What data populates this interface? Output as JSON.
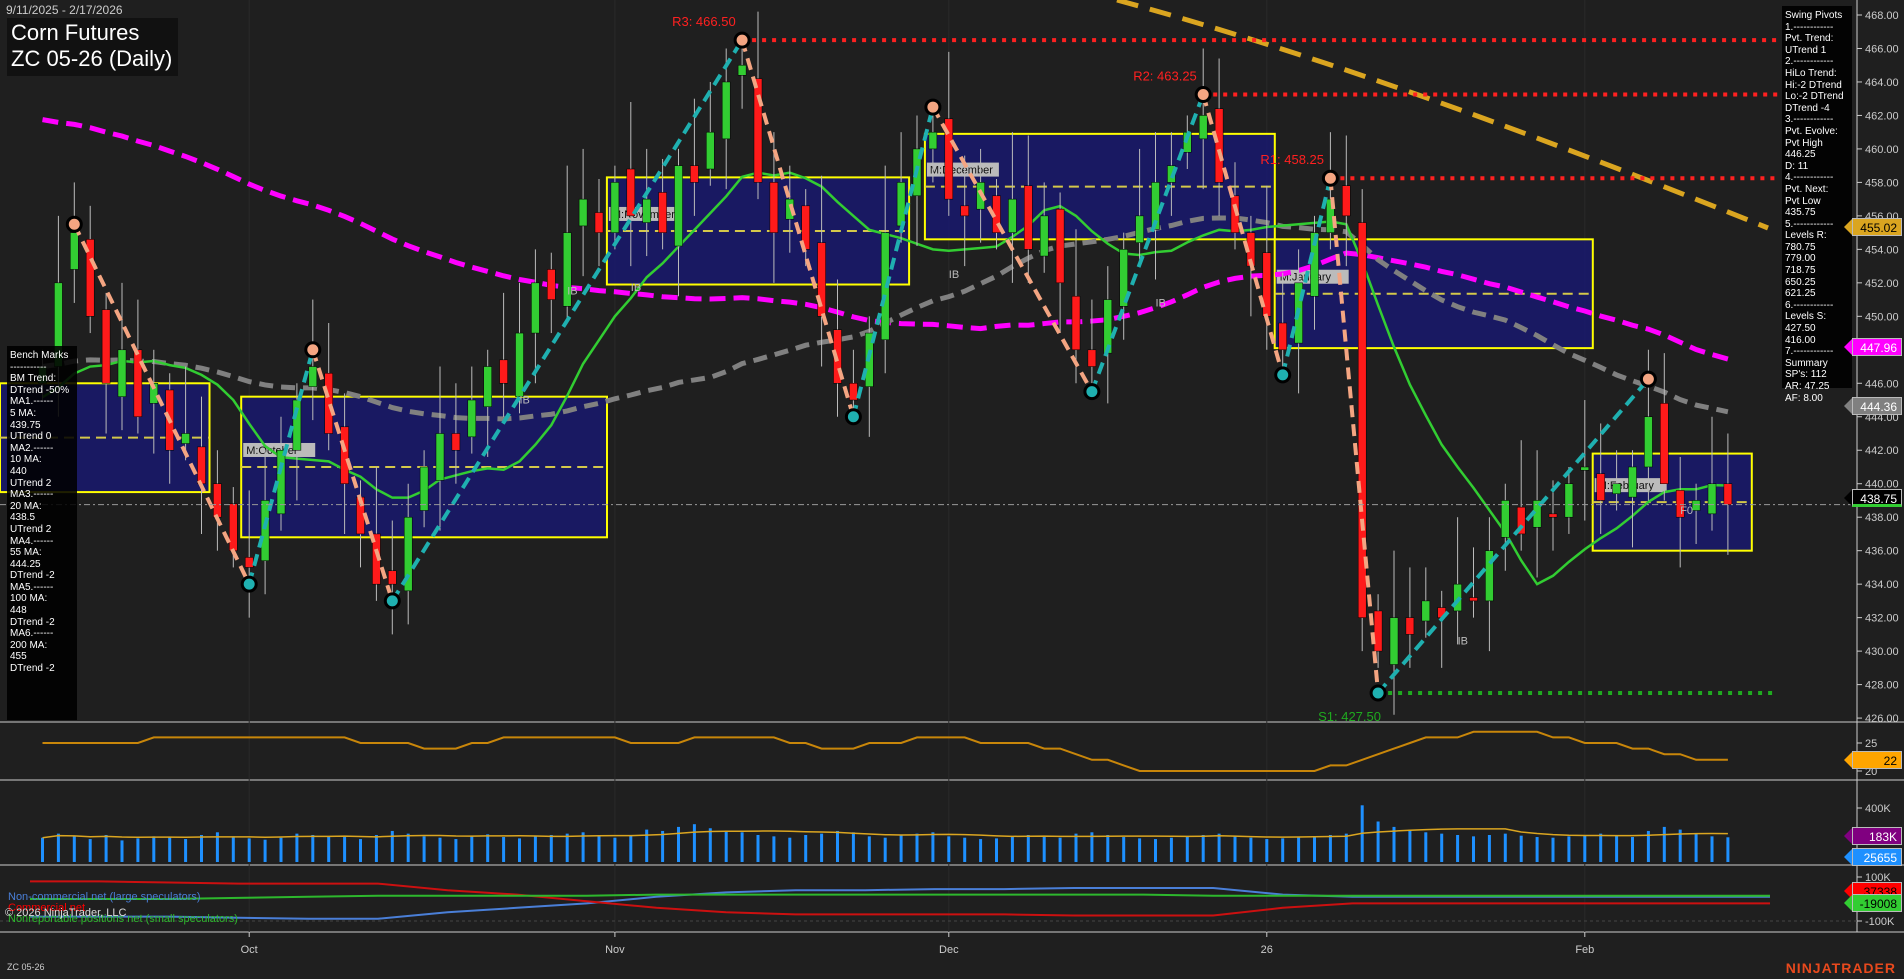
{
  "header": {
    "date_range": "9/11/2025 - 2/17/2026",
    "title_line1": "Corn Futures",
    "title_line2": "ZC 05-26 (Daily)"
  },
  "footer": {
    "symbol": "ZC 05-26",
    "brand": "NINJATRADER",
    "copyright": "© 2026 NinjaTrader, LLC"
  },
  "bench_marks": [
    "Bench Marks",
    "-----------",
    "BM Trend:",
    "DTrend -50%",
    "MA1.------",
    "5 MA:",
    "439.75",
    "UTrend 0",
    "MA2.------",
    "10 MA:",
    "440",
    "UTrend 2",
    "MA3.------",
    "20 MA:",
    "438.5",
    "UTrend 2",
    "MA4.------",
    "55 MA:",
    "444.25",
    "DTrend -2",
    "MA5.------",
    "100 MA:",
    "448",
    "DTrend -2",
    "MA6.------",
    "200 MA:",
    "455",
    "DTrend -2"
  ],
  "swing_pivots": [
    "Swing Pivots",
    "1.------------",
    "Pvt. Trend:",
    "UTrend 1",
    "2.------------",
    "HiLo Trend:",
    "Hi:-2 DTrend",
    "Lo:-2 DTrend",
    "DTrend -4",
    "3.------------",
    "Pvt. Evolve:",
    "Pvt High",
    "446.25",
    "D: 11",
    "4.------------",
    "Pvt. Next:",
    "Pvt Low",
    "435.75",
    "5.------------",
    "Levels R:",
    "780.75",
    "779.00",
    "718.75",
    "650.25",
    "621.25",
    "6.------------",
    "Levels S:",
    "427.50",
    "416.00",
    "7.------------",
    "Summary",
    "SP's: 112",
    "AR: 47.25",
    "AF: 8.00"
  ],
  "badges": {
    "ma200": {
      "value": "455.02",
      "color": "#daa520"
    },
    "ma100": {
      "value": "447.96",
      "color": "#ff00ff"
    },
    "ma55": {
      "value": "444.36",
      "color": "#808080"
    },
    "last": {
      "value": "438.75",
      "color": "#000000"
    },
    "adx": {
      "value": "22",
      "color": "#ffa500"
    },
    "vol": {
      "value": "183K",
      "color": "#800080"
    },
    "vol2": {
      "value": "25655",
      "color": "#1e90ff"
    },
    "commercial": {
      "value": "37338",
      "color": "#ff0000"
    },
    "nonrep": {
      "value": "-19008",
      "color": "#32cd32"
    }
  },
  "legend": {
    "noncommercial": "Non-commercial net (large speculators)",
    "commercial": "Commercial net",
    "nonreportable": "Nonreportable positions net (small speculators)"
  },
  "chart_data": {
    "type": "candlestick",
    "price_axis": {
      "min": 426,
      "max": 468,
      "step": 2,
      "ticks": [
        "468.00",
        "466.00",
        "464.00",
        "462.00",
        "460.00",
        "458.00",
        "456.00",
        "454.00",
        "452.00",
        "450.00",
        "448.00",
        "446.00",
        "444.00",
        "442.00",
        "440.00",
        "438.00",
        "436.00",
        "434.00",
        "432.00",
        "430.00",
        "428.00",
        "426.00"
      ]
    },
    "x_ticks": [
      {
        "label": "Oct",
        "index": 13
      },
      {
        "label": "Nov",
        "index": 36
      },
      {
        "label": "Dec",
        "index": 57
      },
      {
        "label": "26",
        "index": 77
      },
      {
        "label": "Feb",
        "index": 97
      }
    ],
    "closes": [
      447,
      452,
      455,
      450,
      446,
      448,
      444,
      446,
      442,
      443,
      440,
      438,
      436,
      435,
      439,
      442,
      445,
      447,
      443,
      440,
      437,
      434,
      434,
      438,
      441,
      443,
      442,
      445,
      447,
      446,
      449,
      452,
      451,
      455,
      457,
      455,
      458,
      456,
      457,
      455,
      459,
      458,
      461,
      464,
      465,
      458,
      455,
      457,
      454,
      450,
      446,
      445,
      449,
      455,
      458,
      460,
      461,
      457,
      456,
      458,
      455,
      457,
      454,
      456,
      452,
      448,
      447,
      451,
      454,
      456,
      458,
      459,
      461,
      462,
      458,
      455,
      453,
      450,
      448,
      452,
      455,
      457,
      456,
      432,
      430,
      432,
      431,
      433,
      432,
      434,
      433,
      436,
      439,
      437,
      439,
      438,
      440,
      441,
      439,
      440,
      441,
      444,
      440,
      438,
      439,
      440,
      438.75
    ],
    "volume_k": [
      180,
      210,
      190,
      170,
      200,
      160,
      175,
      190,
      185,
      170,
      200,
      220,
      190,
      175,
      165,
      180,
      210,
      200,
      190,
      185,
      170,
      200,
      230,
      210,
      190,
      180,
      170,
      195,
      205,
      185,
      175,
      190,
      200,
      210,
      220,
      190,
      180,
      200,
      240,
      230,
      260,
      280,
      250,
      230,
      220,
      200,
      190,
      180,
      200,
      210,
      230,
      220,
      190,
      180,
      200,
      210,
      220,
      190,
      180,
      170,
      175,
      185,
      200,
      190,
      180,
      210,
      220,
      200,
      185,
      175,
      170,
      180,
      190,
      200,
      210,
      190,
      180,
      170,
      175,
      185,
      190,
      200,
      210,
      420,
      300,
      260,
      240,
      220,
      210,
      200,
      190,
      200,
      210,
      195,
      185,
      180,
      190,
      200,
      210,
      195,
      185,
      230,
      260,
      240,
      210,
      190,
      183
    ],
    "adx": [
      25,
      25,
      25,
      25,
      25,
      25,
      25,
      26,
      26,
      26,
      26,
      26,
      26,
      26,
      26,
      26,
      26,
      26,
      26,
      26,
      25,
      25,
      25,
      25,
      24,
      24,
      24,
      25,
      25,
      26,
      26,
      26,
      26,
      26,
      26,
      26,
      26,
      25,
      25,
      25,
      25,
      26,
      26,
      26,
      26,
      26,
      26,
      25,
      25,
      24,
      24,
      24,
      25,
      25,
      25,
      26,
      26,
      26,
      26,
      25,
      25,
      25,
      25,
      24,
      24,
      23,
      22,
      22,
      21,
      20,
      20,
      20,
      20,
      20,
      20,
      20,
      20,
      20,
      20,
      20,
      20,
      21,
      21,
      22,
      23,
      24,
      25,
      26,
      26,
      26,
      27,
      27,
      27,
      27,
      27,
      26,
      26,
      25,
      25,
      25,
      24,
      24,
      23,
      23,
      22,
      22,
      22
    ],
    "cot": {
      "noncommercial": [
        -80,
        -80,
        -80,
        -85,
        -90,
        -90,
        -60,
        -40,
        -20,
        10,
        30,
        40,
        40,
        45,
        45,
        50,
        50,
        50,
        20,
        10,
        10,
        10,
        10,
        10,
        10,
        10
      ],
      "commercial": [
        80,
        80,
        75,
        70,
        70,
        70,
        40,
        20,
        -10,
        -40,
        -60,
        -70,
        -70,
        -70,
        -70,
        -75,
        -75,
        -75,
        -40,
        -20,
        -20,
        -20,
        -20,
        -20,
        -20,
        -20
      ],
      "nonreportable": [
        0,
        0,
        0,
        5,
        10,
        15,
        15,
        15,
        15,
        20,
        20,
        20,
        20,
        20,
        20,
        20,
        20,
        15,
        15,
        15,
        15,
        15,
        15,
        15,
        15,
        15
      ]
    },
    "pivots": [
      {
        "index": 2,
        "price": 455.5
      },
      {
        "index": 13,
        "price": 434
      },
      {
        "index": 17,
        "price": 448
      },
      {
        "index": 22,
        "price": 433
      },
      {
        "index": 44,
        "price": 466.5
      },
      {
        "index": 51,
        "price": 444
      },
      {
        "index": 56,
        "price": 462.5
      },
      {
        "index": 66,
        "price": 445.5
      },
      {
        "index": 73,
        "price": 463.25
      },
      {
        "index": 78,
        "price": 446.5
      },
      {
        "index": 81,
        "price": 458.25
      },
      {
        "index": 84,
        "price": 427.5
      },
      {
        "index": 101,
        "price": 446.25
      }
    ],
    "levels": [
      {
        "label": "R3: 466.50",
        "price": 466.5,
        "index": 44,
        "color": "#ff2020"
      },
      {
        "label": "R2: 463.25",
        "price": 463.25,
        "index": 73,
        "color": "#ff2020"
      },
      {
        "label": "R1: 458.25",
        "price": 458.25,
        "index": 81,
        "color": "#ff2020"
      },
      {
        "label": "S1: 427.50",
        "price": 427.5,
        "index": 84,
        "color": "#1faa1f"
      }
    ],
    "month_boxes": [
      {
        "label": "",
        "start": -3,
        "end": 10,
        "high": 446.0,
        "low": 439.5
      },
      {
        "label": "M:October",
        "start": 13,
        "end": 35,
        "high": 445.2,
        "low": 436.8
      },
      {
        "label": "M:November",
        "start": 36,
        "end": 54,
        "high": 458.3,
        "low": 451.9
      },
      {
        "label": "M:December",
        "start": 56,
        "end": 77,
        "high": 460.9,
        "low": 454.6
      },
      {
        "label": "M:January",
        "start": 78,
        "end": 97,
        "high": 454.6,
        "low": 448.1
      },
      {
        "label": "M:February",
        "start": 98,
        "end": 107,
        "high": 441.8,
        "low": 436.0
      }
    ],
    "ib_labels": [
      {
        "text": "IB",
        "index": 33,
        "price": 451.3
      },
      {
        "text": "IB",
        "index": 37,
        "price": 451.5
      },
      {
        "text": "IB",
        "index": 30,
        "price": 444.8
      },
      {
        "text": "IB",
        "index": 57,
        "price": 452.3
      },
      {
        "text": "IB",
        "index": 70,
        "price": 450.6
      },
      {
        "text": "IB",
        "index": 89,
        "price": 430.4
      },
      {
        "text": "F0",
        "index": 103,
        "price": 438.2
      }
    ]
  }
}
